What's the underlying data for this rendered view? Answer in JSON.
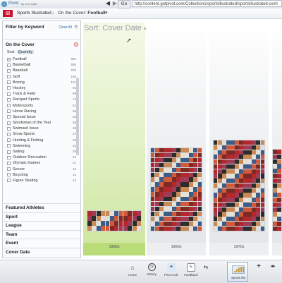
{
  "app": {
    "name": "Pivot",
    "by": "by Live Labs"
  },
  "nav": {
    "back": "◀",
    "forward": "▶",
    "go": "Go",
    "address": "http://content.getpivot.com/Collections/sportsillustrated/sportsillustrated.cxml"
  },
  "breadcrumb": {
    "logo": "SI",
    "collection": "Sports Illustrated",
    "filter_prefix": "On the Cover:",
    "filter_value": "Football",
    "chevron": "▾"
  },
  "filter_panel": {
    "title": "Filter by Keyword",
    "clear_all": "Clear All",
    "section_title": "On the Cover",
    "sort_label": "Sort:",
    "sort_value": "Quantity",
    "items": [
      {
        "label": "Football",
        "count": "882",
        "checked": true
      },
      {
        "label": "Basketball",
        "count": "595",
        "checked": false
      },
      {
        "label": "Baseball",
        "count": "570",
        "checked": false
      },
      {
        "label": "Golf",
        "count": "158",
        "checked": false
      },
      {
        "label": "Boxing",
        "count": "131",
        "checked": false
      },
      {
        "label": "Hockey",
        "count": "91",
        "checked": false
      },
      {
        "label": "Track & Field",
        "count": "89",
        "checked": false
      },
      {
        "label": "Racquet Sports",
        "count": "74",
        "checked": false
      },
      {
        "label": "Motorsports",
        "count": "61",
        "checked": false
      },
      {
        "label": "Horse Racing",
        "count": "56",
        "checked": false
      },
      {
        "label": "Special Issue",
        "count": "53",
        "checked": false
      },
      {
        "label": "Sportsman of the Year",
        "count": "50",
        "checked": false
      },
      {
        "label": "Swimsuit Issue",
        "count": "48",
        "checked": false
      },
      {
        "label": "Snow Sports",
        "count": "37",
        "checked": false
      },
      {
        "label": "Hunting & Fishing",
        "count": "32",
        "checked": false
      },
      {
        "label": "Swimming",
        "count": "31",
        "checked": false
      },
      {
        "label": "Sailing",
        "count": "29",
        "checked": false
      },
      {
        "label": "Outdoor Recreation",
        "count": "22",
        "checked": false
      },
      {
        "label": "Olympic Games",
        "count": "21",
        "checked": false
      },
      {
        "label": "Soccer",
        "count": "16",
        "checked": false
      },
      {
        "label": "Bicycling",
        "count": "14",
        "checked": false
      },
      {
        "label": "Figure Skating",
        "count": "13",
        "checked": false
      }
    ],
    "sections": [
      "Featured Athletes",
      "Sport",
      "League",
      "Team",
      "Event",
      "Cover Date"
    ]
  },
  "main": {
    "sort_label": "Sort: Cover Date",
    "sort_chevron": "▾",
    "columns": [
      {
        "label": "1950s",
        "selected": true
      },
      {
        "label": "1960s",
        "selected": false
      },
      {
        "label": "1970s",
        "selected": false
      },
      {
        "label": "",
        "selected": false
      }
    ]
  },
  "taskbar": {
    "buttons": [
      {
        "label": "Home",
        "icon": "home-icon"
      },
      {
        "label": "History",
        "icon": "history-icon"
      },
      {
        "label": "Pivot Coll.",
        "icon": "pivot-collection-icon"
      },
      {
        "label": "Feedback",
        "icon": "feedback-icon"
      }
    ],
    "active_tab": "Sports Illu",
    "add_tab": "+"
  }
}
